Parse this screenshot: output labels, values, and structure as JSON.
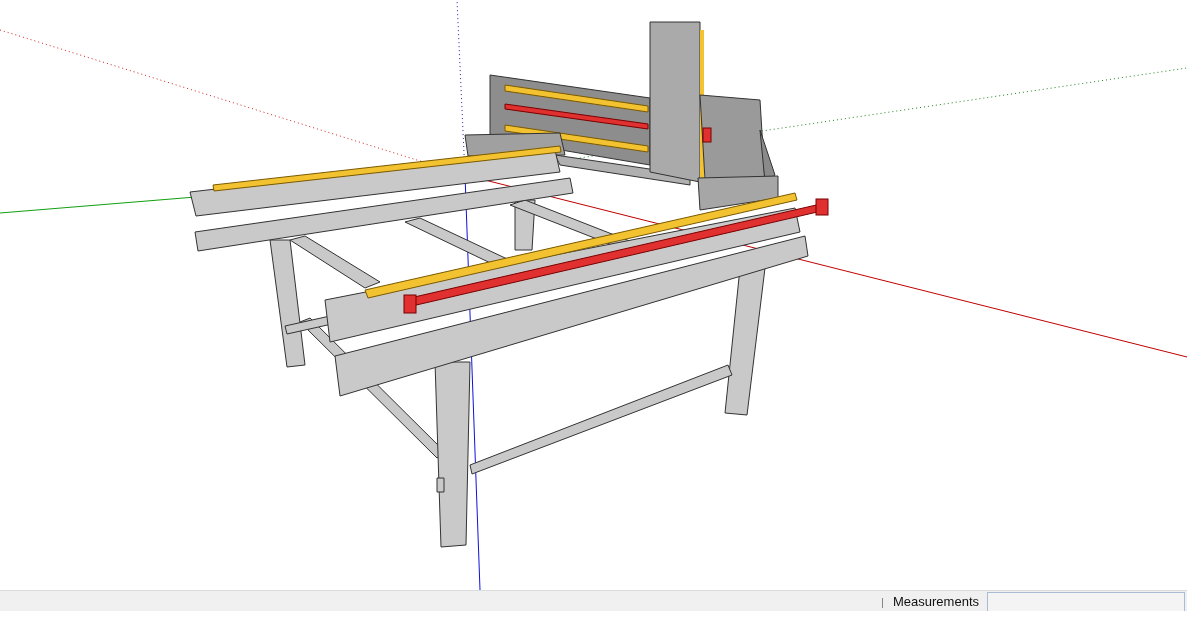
{
  "status_bar": {
    "measurements_label": "Measurements"
  }
}
